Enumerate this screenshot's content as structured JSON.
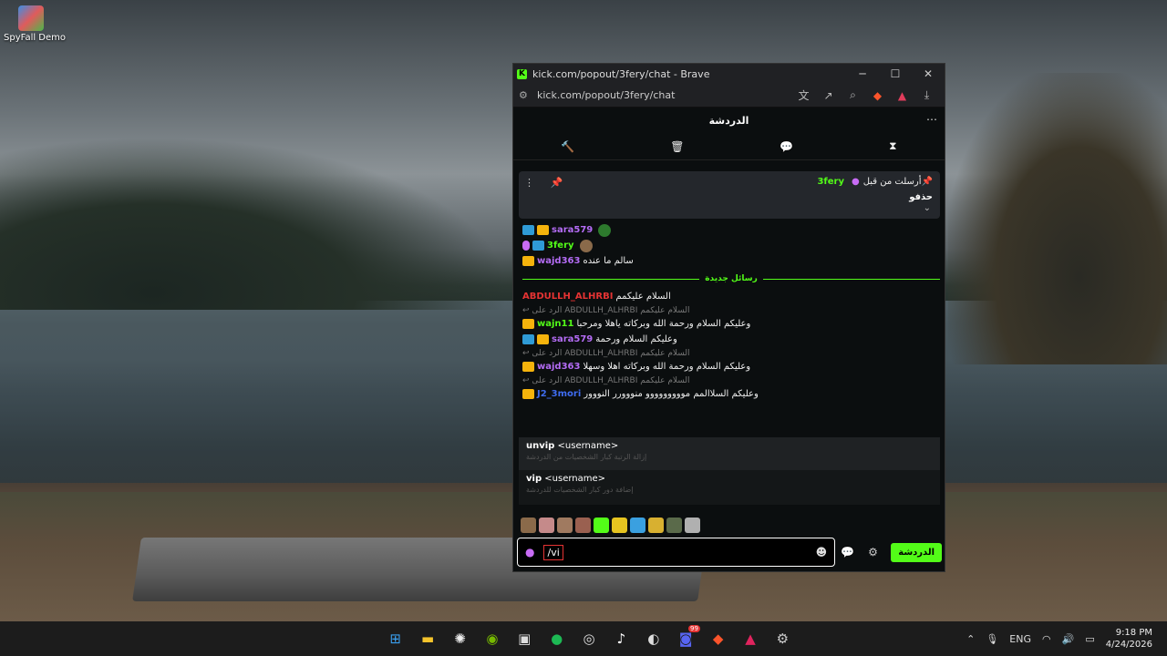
{
  "desktop": {
    "icon_label": "SpyFall Demo"
  },
  "window": {
    "title": "kick.com/popout/3fery/chat - Brave",
    "url": "kick.com/popout/3fery/chat",
    "minimize": "─",
    "maximize": "☐",
    "close": "✕"
  },
  "chat": {
    "header": "الدردشة",
    "more": "⋯",
    "pinned": {
      "sent_by": "أرسلت من قبل",
      "username": "3fery",
      "message": "حذفو"
    },
    "messages_top": [
      {
        "user": "sara579",
        "color": "purple",
        "badges": [
          "mod",
          "crown"
        ],
        "text": ""
      },
      {
        "user": "3fery",
        "color": "green",
        "badges": [
          "mic",
          "mod"
        ],
        "text": ""
      },
      {
        "user": "wajd363",
        "color": "purple",
        "badges": [
          "crown"
        ],
        "text": "سالم ما عنده"
      }
    ],
    "divider": "رسائل جديدة",
    "messages": [
      {
        "user": "ABDULLH_ALHRBI",
        "color": "red",
        "text": "السلام عليكمم"
      },
      {
        "reply": "الرد على ABDULLH_ALHRBI السلام عليكمم"
      },
      {
        "user": "wajn11",
        "color": "green",
        "text": "وعليكم السلام ورحمة الله وبركاته ياهلا ومرحبا"
      },
      {
        "user": "sara579",
        "color": "purple",
        "text": "وعليكم السلام ورحمة"
      },
      {
        "reply": "الرد على ABDULLH_ALHRBI السلام عليكمم"
      },
      {
        "user": "wajd363",
        "color": "purple",
        "text": "وعليكم السلام ورحمة الله وبركاته اهلا وسهلا"
      },
      {
        "reply": "الرد على ABDULLH_ALHRBI السلام عليكمم"
      },
      {
        "user": "J2_3mori",
        "color": "blue",
        "text": "وعليكم السلاالمم مووووووووو منووورر النووور"
      }
    ],
    "suggestions": [
      {
        "cmd": "unvip",
        "arg": "<username>",
        "desc": "إزالة الرتبة كبار الشخصيات من الدردشة"
      },
      {
        "cmd": "vip",
        "arg": "<username>",
        "desc": "إضافة دور كبار الشخصيات للدردشة"
      }
    ],
    "input_value": "/vi",
    "send_label": "الدردشة"
  },
  "taskbar": {
    "lang": "ENG",
    "time": "9:18 PM",
    "date": "4/24/2026",
    "badge_count": "99"
  },
  "colors": {
    "kick_green": "#53fc18",
    "bg": "#0b0e0f"
  }
}
